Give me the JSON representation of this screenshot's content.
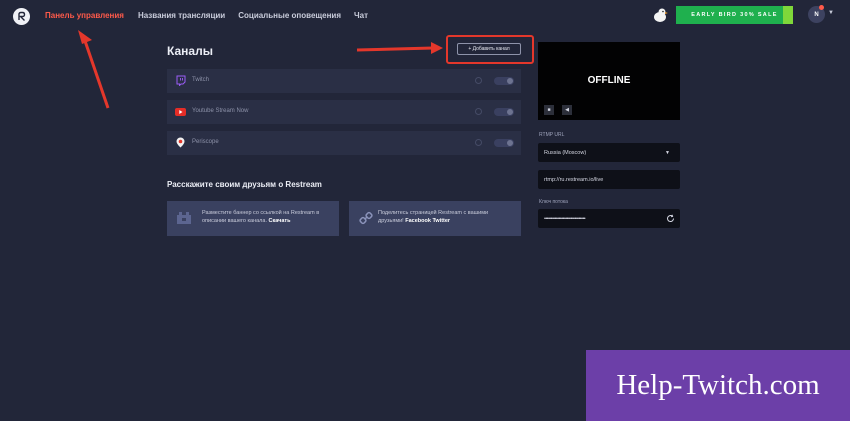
{
  "nav": {
    "items": [
      {
        "label": "Панель управления",
        "active": true
      },
      {
        "label": "Названия трансляции",
        "active": false
      },
      {
        "label": "Социальные оповещения",
        "active": false
      },
      {
        "label": "Чат",
        "active": false
      }
    ]
  },
  "promo": {
    "label": "EARLY BIRD 30% SALE"
  },
  "user": {
    "avatar_letter": "N"
  },
  "channels": {
    "title": "Каналы",
    "add_button": "+ Добавить канал",
    "items": [
      {
        "name": "Twitch",
        "icon": "twitch-icon"
      },
      {
        "name": "Youtube Stream Now",
        "icon": "youtube-icon"
      },
      {
        "name": "Periscope",
        "icon": "periscope-icon"
      }
    ]
  },
  "share": {
    "title": "Расскажите своим друзьям о Restream",
    "cards": [
      {
        "text": "Разместите баннер со ссылкой на Restream в описании вашего канала.",
        "link": "Скачать",
        "icon": "banner-icon"
      },
      {
        "text": "Поделитесь страницей Restream с вашими друзьями!",
        "link": "Facebook Twitter",
        "icon": "link-icon"
      }
    ]
  },
  "preview": {
    "status": "OFFLINE"
  },
  "rtmp": {
    "label": "RTMP URL",
    "server": "Russia (Moscow)",
    "url": "rtmp://ru.restream.io/live",
    "key_label": "Ключ потока",
    "key_value": "•••••••••••••••••••••••••••••••"
  },
  "watermark": {
    "text": "Help-Twitch.com"
  },
  "colors": {
    "accent": "#ff5a4a",
    "background": "#222639",
    "card": "#2a2f45",
    "promo": "#1fb04e",
    "watermark": "#6c3fa8",
    "annotation": "#e4372b"
  }
}
